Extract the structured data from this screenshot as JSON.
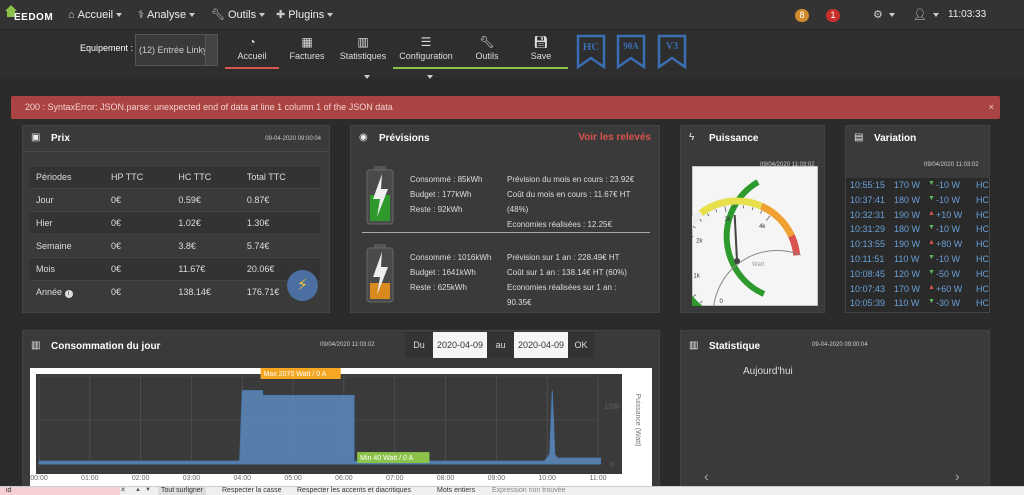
{
  "navbar": {
    "logo_text": "EEDOM",
    "menus": [
      {
        "label": "Accueil",
        "icon": "home-icon"
      },
      {
        "label": "Analyse",
        "icon": "stethoscope-icon"
      },
      {
        "label": "Outils",
        "icon": "wrench-icon"
      },
      {
        "label": "Plugins",
        "icon": "puzzle-icon"
      }
    ],
    "badge_orange": "8",
    "badge_red": "1",
    "time": "11:03:33"
  },
  "toolbar": {
    "equipement_label": "Equipement :",
    "equipement_value": "(12) Entrée Linky",
    "buttons": [
      "Accueil",
      "Factures",
      "Statistiques",
      "Configuration",
      "Outils",
      "Save"
    ],
    "banners": [
      "HC",
      "90A",
      "V3"
    ]
  },
  "alert": {
    "message": "200 : SyntaxError: JSON.parse: unexpected end of data at line 1 column 1 of the JSON data",
    "close": "×"
  },
  "prix": {
    "title": "Prix",
    "date": "09-04-2020 09:00:04",
    "headers": [
      "Périodes",
      "HP TTC",
      "HC TTC",
      "Total TTC"
    ],
    "rows": [
      [
        "Jour",
        "0€",
        "0.59€",
        "0.87€"
      ],
      [
        "Hier",
        "0€",
        "1.02€",
        "1.30€"
      ],
      [
        "Semaine",
        "0€",
        "3.8€",
        "5.74€"
      ],
      [
        "Mois",
        "0€",
        "11.67€",
        "20.06€"
      ],
      [
        "Année",
        "0€",
        "138.14€",
        "176.71€"
      ]
    ]
  },
  "previsions": {
    "title": "Prévisions",
    "link": "Voir les relevés",
    "block1": {
      "left": [
        "Consommé : 85kWh",
        "Budget : 177kWh",
        "Reste : 92kWh"
      ],
      "right": [
        "Prévision du mois en cours : 23.92€",
        "Coût du mois en cours : 11.67€ HT",
        "(48%)",
        "Economies réalisées : 12.25€"
      ]
    },
    "block2": {
      "left": [
        "Consommé : 1016kWh",
        "Budget : 1641kWh",
        "Reste : 625kWh"
      ],
      "right": [
        "Prévision sur 1 an : 228.49€ HT",
        "Coût sur 1 an : 138.14€ HT (60%)",
        "Economies réalisées sur 1 an :",
        "90.35€"
      ]
    }
  },
  "puissance": {
    "title": "Puissance",
    "date": "09/04/2020 11:03:02",
    "gauge_ticks": [
      "0",
      "1k",
      "2k",
      "3k",
      "4k"
    ],
    "gauge_unit": "Watt",
    "gauge_value": 3.2,
    "gauge_max": 5
  },
  "variation": {
    "title": "Variation",
    "date": "09/04/2020 11:03:02",
    "rows": [
      {
        "time": "10:55:15",
        "power": "170 W",
        "delta": "-10 W",
        "dir": "down",
        "tarif": "HC"
      },
      {
        "time": "10:37:41",
        "power": "180 W",
        "delta": "-10 W",
        "dir": "down",
        "tarif": "HC"
      },
      {
        "time": "10:32:31",
        "power": "190 W",
        "delta": "+10 W",
        "dir": "up",
        "tarif": "HC"
      },
      {
        "time": "10:31:29",
        "power": "180 W",
        "delta": "-10 W",
        "dir": "down",
        "tarif": "HC"
      },
      {
        "time": "10:13:55",
        "power": "190 W",
        "delta": "+80 W",
        "dir": "up",
        "tarif": "HC"
      },
      {
        "time": "10:11:51",
        "power": "110 W",
        "delta": "-10 W",
        "dir": "down",
        "tarif": "HC"
      },
      {
        "time": "10:08:45",
        "power": "120 W",
        "delta": "-50 W",
        "dir": "down",
        "tarif": "HC"
      },
      {
        "time": "10:07:43",
        "power": "170 W",
        "delta": "+60 W",
        "dir": "up",
        "tarif": "HC"
      },
      {
        "time": "10:05:39",
        "power": "110 W",
        "delta": "-30 W",
        "dir": "down",
        "tarif": "HC"
      }
    ]
  },
  "conso": {
    "title": "Consommation du jour",
    "date": "09/04/2020 11:03:02",
    "du_label": "Du",
    "du_value": "2020-04-09",
    "au_label": "au",
    "au_value": "2020-04-09",
    "ok_label": "OK"
  },
  "statistique": {
    "title": "Statistique",
    "date": "09-04-2020 09:00:04",
    "subtitle": "Aujourd'hui"
  },
  "chart_data": {
    "type": "area",
    "ylabel": "Puissance (Watt)",
    "x_ticks": [
      "00:00",
      "01:00",
      "02:00",
      "03:00",
      "04:00",
      "05:00",
      "06:00",
      "07:00",
      "08:00",
      "09:00",
      "10:00",
      "11:00"
    ],
    "y_ticks": [
      0,
      1200
    ],
    "ylim": [
      0,
      1800
    ],
    "x_hours": [
      0,
      3.95,
      4.0,
      4.4,
      4.4,
      6.2,
      6.2,
      9.95,
      10.05,
      10.1,
      10.15,
      10.2,
      11.05
    ],
    "values": [
      60,
      60,
      1500,
      1500,
      1400,
      1400,
      60,
      60,
      200,
      1500,
      200,
      120,
      120
    ],
    "annotations": [
      {
        "text": "Max 2070 Watt / 0 A",
        "x_hour": 4.4,
        "y": 1800,
        "color": "#f5a623"
      },
      {
        "text": "Min 40 Watt / 0 A",
        "x_hour": 6.3,
        "y": 80,
        "color": "#8bc34a"
      }
    ]
  },
  "findbar": {
    "input_value": "id",
    "options": [
      "Tout surligner",
      "Respecter la casse",
      "Respecter les accents et diacritiques",
      "Mots entiers"
    ],
    "status": "Expression non trouvée"
  }
}
